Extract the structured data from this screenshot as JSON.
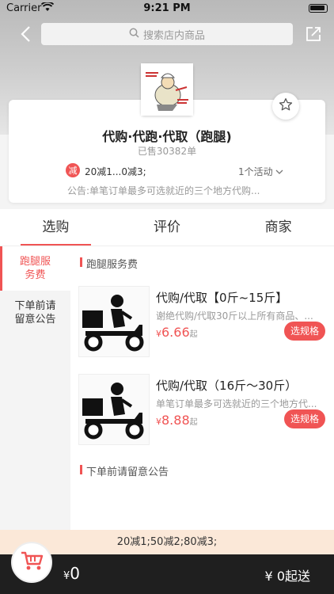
{
  "status_bar": {
    "carrier": "Carrier",
    "time": "9:21 PM"
  },
  "header": {
    "search_placeholder": "搜索店内商品"
  },
  "store": {
    "name": "代购·代跑·代取（跑腿)",
    "sold": "已售30382单",
    "promo_badge": "减",
    "promo_text": "20减1...0减3;",
    "activity": "1个活动",
    "notice": "公告:单笔订单最多可选就近的三个地方代购..."
  },
  "tabs": [
    {
      "label": "选购"
    },
    {
      "label": "评价"
    },
    {
      "label": "商家"
    }
  ],
  "categories": [
    {
      "label": "跑腿服务费"
    },
    {
      "label": "下单前请留意公告"
    }
  ],
  "sections": [
    {
      "title": "跑腿服务费"
    },
    {
      "title": "下单前请留意公告"
    }
  ],
  "products": [
    {
      "title": "代购/代取【0斤~15斤】",
      "desc": "谢绝代购/代取30斤以上所有商品、...",
      "currency": "¥",
      "price": "6.66",
      "price_unit": "起",
      "spec_button": "选规格"
    },
    {
      "title": "代购/代取（16斤～30斤）",
      "desc": "单笔订单最多可选就近的三个地方代...",
      "currency": "¥",
      "price": "8.88",
      "price_unit": "起",
      "spec_button": "选规格"
    }
  ],
  "promo_strip": "20减1;50减2;80减3;",
  "cart": {
    "currency": "¥",
    "total": "0",
    "min_order": "¥ 0起送"
  },
  "colors": {
    "accent": "#f05454",
    "bottom_bar": "#1f1f1f",
    "strip": "#fbe8d8"
  }
}
